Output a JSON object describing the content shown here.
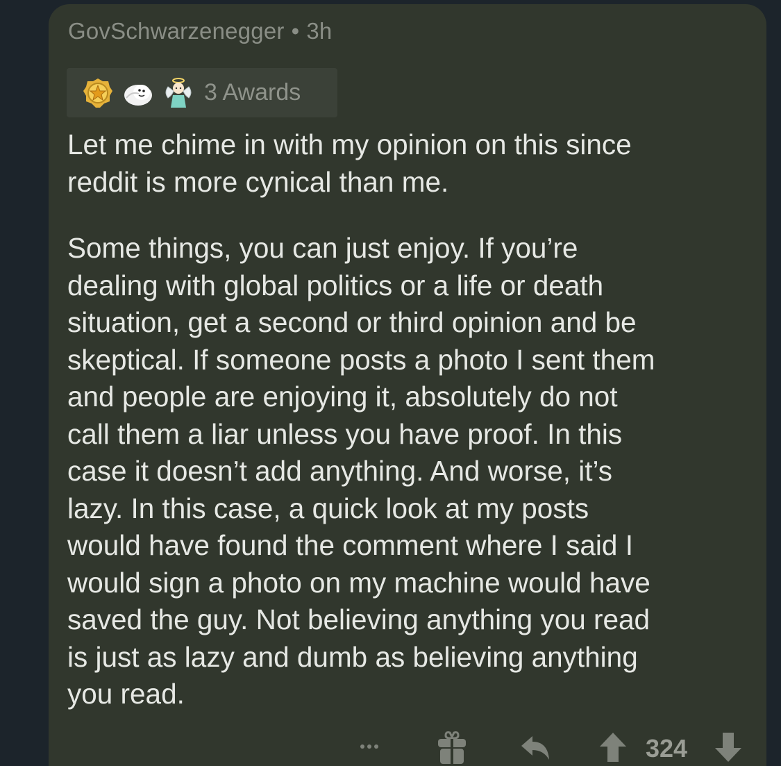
{
  "comment": {
    "author": "GovSchwarzenegger",
    "separator": "•",
    "age": "3h",
    "awards": {
      "label": "3 Awards",
      "icons": [
        "gold-star-award-icon",
        "seal-award-icon",
        "angel-award-icon"
      ]
    },
    "paragraphs": [
      "Let me chime in with my opinion on this since\nreddit is more cynical than me.",
      "Some things, you can just enjoy. If you’re\ndealing with global politics or a life or death\nsituation, get a second or third opinion and be\nskeptical. If someone posts a photo I sent them\nand people are enjoying it, absolutely do not\ncall them a liar unless you have proof. In this\ncase it doesn’t add anything. And worse, it’s\nlazy. In this case, a quick look at my posts\nwould have found the comment where I said I\nwould sign a photo on my machine would have\nsaved the guy. Not believing anything you read\nis just as lazy and dumb as believing anything\nyou read."
    ],
    "actions": {
      "more_icon": "more-options-icon",
      "give_award_icon": "gift-icon",
      "reply_icon": "reply-icon",
      "upvote_icon": "upvote-icon",
      "vote_count": "324",
      "downvote_icon": "downvote-icon"
    }
  },
  "colors": {
    "page_background": "#1c242b",
    "card_background": "#31372d",
    "body_text": "#e6e8e4",
    "meta_text": "#8a8e86",
    "icon_gray": "#7e827a"
  }
}
